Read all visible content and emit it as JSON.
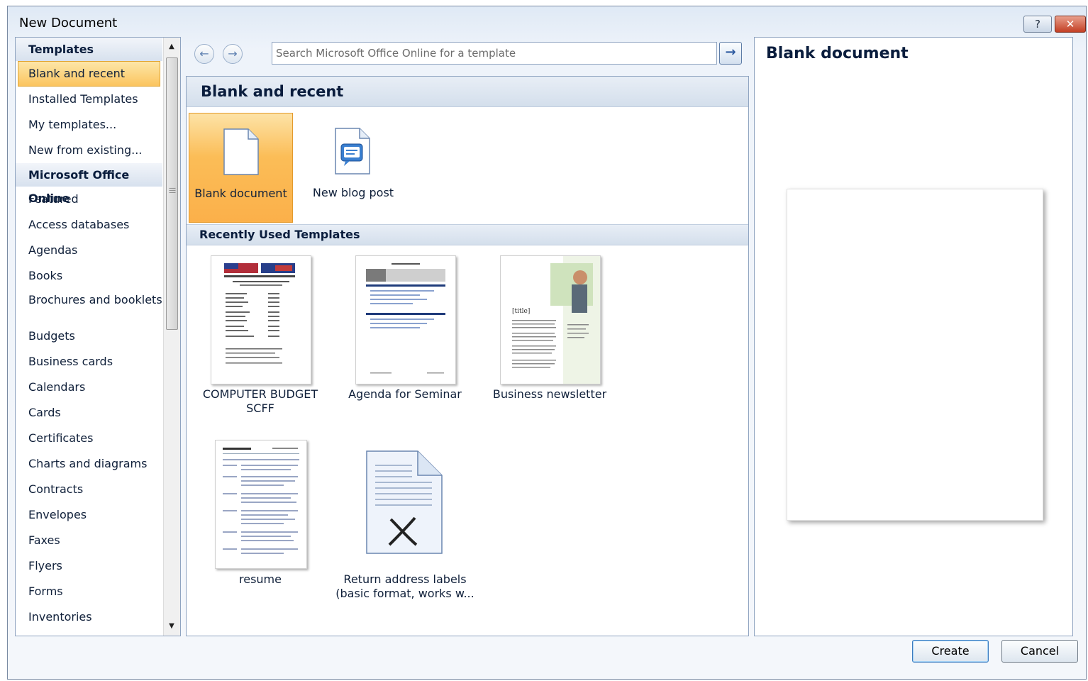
{
  "window": {
    "title": "New Document",
    "help_glyph": "?",
    "close_glyph": "✕"
  },
  "sidebar": {
    "groups": [
      {
        "label": "Templates",
        "items": [
          "Blank and recent",
          "Installed Templates",
          "My templates...",
          "New from existing..."
        ]
      },
      {
        "label": "Microsoft Office Online",
        "items": [
          "Featured",
          "Access databases",
          "Agendas",
          "Books",
          "Brochures and booklets",
          "Budgets",
          "Business cards",
          "Calendars",
          "Cards",
          "Certificates",
          "Charts and diagrams",
          "Contracts",
          "Envelopes",
          "Faxes",
          "Flyers",
          "Forms",
          "Inventories"
        ]
      }
    ],
    "selected": "Blank and recent"
  },
  "nav": {
    "back_glyph": "←",
    "forward_glyph": "→",
    "search_placeholder": "Search Microsoft Office Online for a template",
    "go_glyph": "→"
  },
  "main": {
    "heading": "Blank and recent",
    "tiles": [
      {
        "label": "Blank document",
        "icon": "blank-document-icon"
      },
      {
        "label": "New blog post",
        "icon": "blog-post-icon"
      }
    ],
    "recent_heading": "Recently Used Templates",
    "recent": [
      {
        "label": "COMPUTER BUDGET SCFF"
      },
      {
        "label": "Agenda for Seminar"
      },
      {
        "label": "Business newsletter",
        "thumb_text": "[title]"
      },
      {
        "label": "resume"
      },
      {
        "label": "Return address labels (basic format, works w..."
      }
    ]
  },
  "preview": {
    "title": "Blank document"
  },
  "buttons": {
    "create": "Create",
    "cancel": "Cancel"
  },
  "colors": {
    "selection": "#fbc55f",
    "heading_text": "#0a1d3d",
    "panel_border": "#8ea3c0"
  }
}
